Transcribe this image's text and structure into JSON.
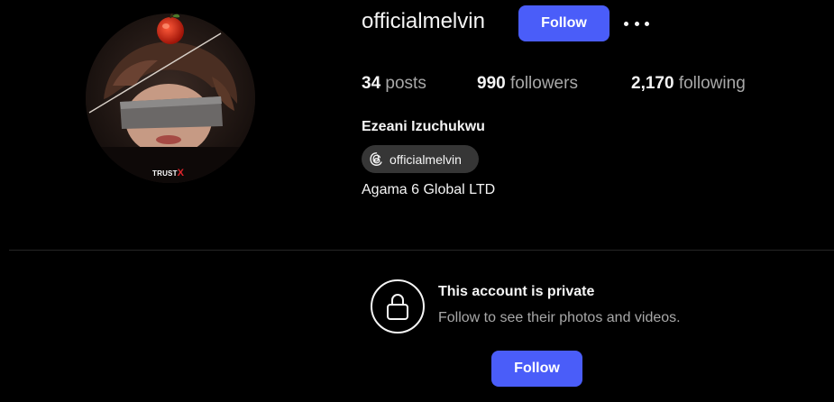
{
  "profile": {
    "username": "officialmelvin",
    "full_name": "Ezeani Izuchukwu",
    "threads_handle": "officialmelvin",
    "bio": "Agama 6 Global LTD",
    "avatar_brand": "TRUST",
    "avatar_brand_mark": "X"
  },
  "header": {
    "follow_label": "Follow",
    "more_icon": "more-horizontal-icon"
  },
  "stats": {
    "posts": {
      "count": "34",
      "label": "posts"
    },
    "followers": {
      "count": "990",
      "label": "followers"
    },
    "following": {
      "count": "2,170",
      "label": "following"
    }
  },
  "private": {
    "title": "This account is private",
    "subtitle": "Follow to see their photos and videos.",
    "follow_label": "Follow",
    "icon": "lock-icon"
  },
  "colors": {
    "background": "#000000",
    "accent": "#4a5df9",
    "text_primary": "#f5f5f5",
    "text_secondary": "#a8a8a8",
    "badge_bg": "#363636",
    "divider": "#262626"
  }
}
